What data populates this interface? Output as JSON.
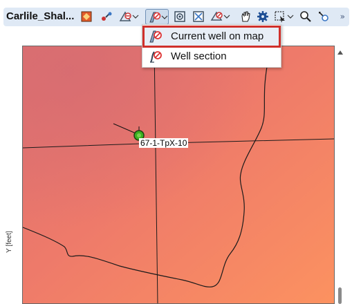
{
  "window": {
    "tab_title": "Carlile_Shal..."
  },
  "toolbar": {
    "icons": [
      "surface-icon",
      "well-link-icon",
      "well-filter-icon",
      "well-display-icon",
      "settings-frame-icon",
      "zoom-extent-icon",
      "layer-icon",
      "pan-hand-icon",
      "gear-icon",
      "select-box-icon",
      "zoom-icon",
      "pick-icon"
    ],
    "overflow_label": "»"
  },
  "dropdown": {
    "items": [
      {
        "label": "Current well on map",
        "icon": "well-map-icon",
        "highlighted": true
      },
      {
        "label": "Well section",
        "icon": "well-section-icon",
        "highlighted": false
      }
    ]
  },
  "map": {
    "well_label": "67-1-TpX-10",
    "y_axis_label": "Y [feet]",
    "colors": {
      "fill_top": "#e17070",
      "fill_bottom_right": "#fb8e62",
      "contour": "#1a1a1a",
      "well_marker": "#3ab020"
    }
  },
  "colors": {
    "toolbar_bg": "#dfe9f5",
    "highlight_border": "#d0302b"
  }
}
